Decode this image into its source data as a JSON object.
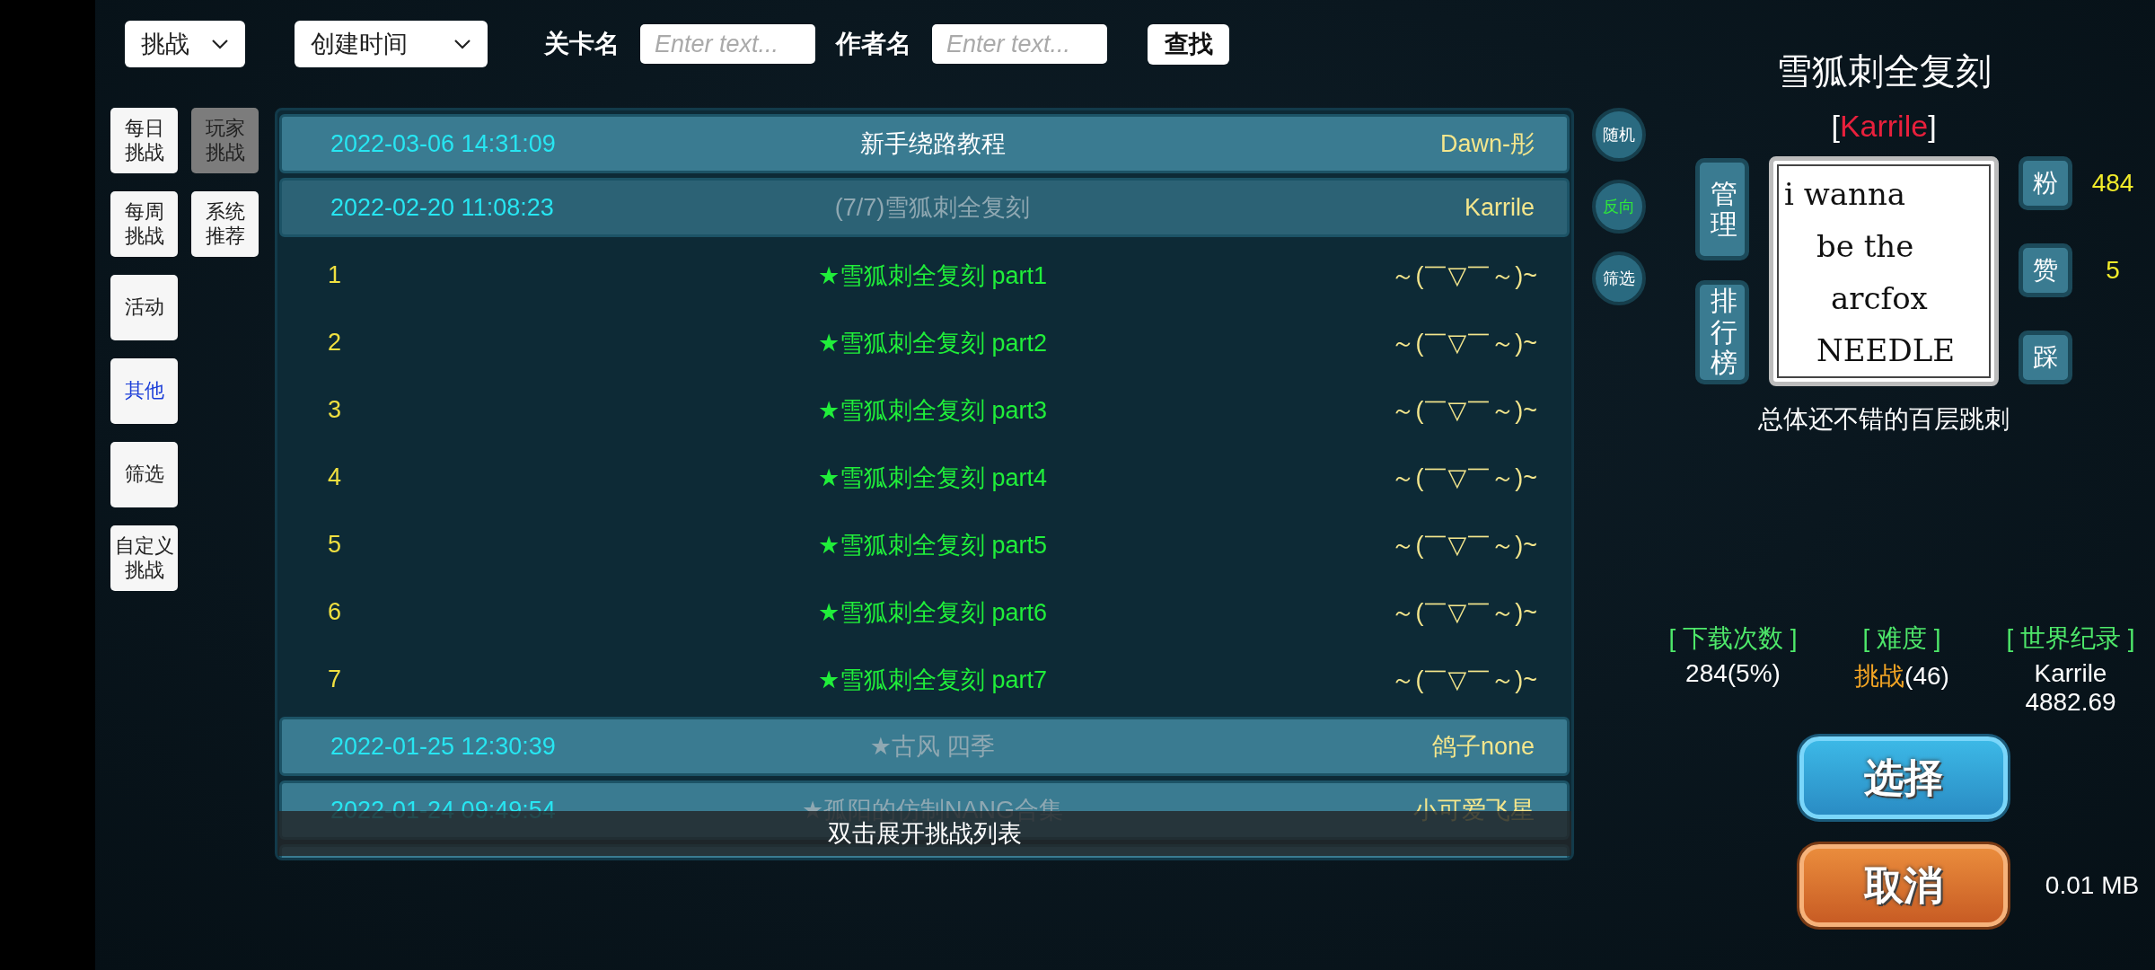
{
  "filters": {
    "category": "挑战",
    "sort": "创建时间",
    "level_label": "关卡名",
    "level_placeholder": "Enter text...",
    "author_label": "作者名",
    "author_placeholder": "Enter text...",
    "search": "查找"
  },
  "sidebar": [
    {
      "label": "每日挑战",
      "selected": false,
      "accent": false
    },
    {
      "label": "玩家挑战",
      "selected": true,
      "accent": false
    },
    {
      "label": "每周挑战",
      "selected": false,
      "accent": false
    },
    {
      "label": "系统推荐",
      "selected": false,
      "accent": false
    },
    {
      "label": "活动",
      "selected": false,
      "accent": false
    },
    {
      "label": "其他",
      "selected": false,
      "accent": true
    },
    {
      "label": "筛选",
      "selected": false,
      "accent": false
    },
    {
      "label": "自定义挑战",
      "selected": false,
      "accent": false
    }
  ],
  "list": {
    "rows": [
      {
        "date": "2022-03-06 14:31:09",
        "title": "新手绕路教程",
        "author": "Dawn-彤",
        "dimmed": false,
        "expanded": false
      },
      {
        "date": "2022-02-20 11:08:23",
        "title": "(7/7)雪狐刺全复刻",
        "author": "Karrile",
        "dimmed": true,
        "expanded": true,
        "children": [
          {
            "number": "1",
            "title": "★雪狐刺全复刻 part1",
            "author": "～(￣▽￣～)~"
          },
          {
            "number": "2",
            "title": "★雪狐刺全复刻 part2",
            "author": "～(￣▽￣～)~"
          },
          {
            "number": "3",
            "title": "★雪狐刺全复刻 part3",
            "author": "～(￣▽￣～)~"
          },
          {
            "number": "4",
            "title": "★雪狐刺全复刻 part4",
            "author": "～(￣▽￣～)~"
          },
          {
            "number": "5",
            "title": "★雪狐刺全复刻 part5",
            "author": "～(￣▽￣～)~"
          },
          {
            "number": "6",
            "title": "★雪狐刺全复刻 part6",
            "author": "～(￣▽￣～)~"
          },
          {
            "number": "7",
            "title": "★雪狐刺全复刻 part7",
            "author": "～(￣▽￣～)~"
          }
        ]
      },
      {
        "date": "2022-01-25 12:30:39",
        "title": "★古风 四季",
        "author": "鸽子none",
        "dimmed": true,
        "expanded": false
      },
      {
        "date": "2022-01-24 09:49:54",
        "title": "★孤阳的仿制NANG合集",
        "author": "小可爱飞星",
        "dimmed": true,
        "expanded": false
      }
    ],
    "toast": "双击展开挑战列表"
  },
  "side_buttons": [
    {
      "label": "随机",
      "active": false
    },
    {
      "label": "反向",
      "active": true
    },
    {
      "label": "筛选",
      "active": false
    }
  ],
  "detail": {
    "title": "雪狐刺全复刻",
    "author_open": "[",
    "author": "Karrile",
    "author_close": "]",
    "manage": "管理",
    "ranking": "排行榜",
    "thumbnail_lines": [
      "i wanna",
      "be the",
      "arcfox",
      "NEEDLE"
    ],
    "reactions": [
      {
        "label": "粉",
        "count": "484"
      },
      {
        "label": "赞",
        "count": "5"
      },
      {
        "label": "踩"
      }
    ],
    "description": "总体还不错的百层跳刺",
    "stats": [
      {
        "heading": "[ 下载次数 ]",
        "value": "284(5%)"
      },
      {
        "heading": "[ 难度 ]",
        "difficulty": "挑战",
        "value": "(46)"
      },
      {
        "heading": "[ 世界纪录 ]",
        "value": "Karrile",
        "value2": "4882.69"
      }
    ],
    "select": "选择",
    "cancel": "取消",
    "size": "0.01 MB"
  }
}
